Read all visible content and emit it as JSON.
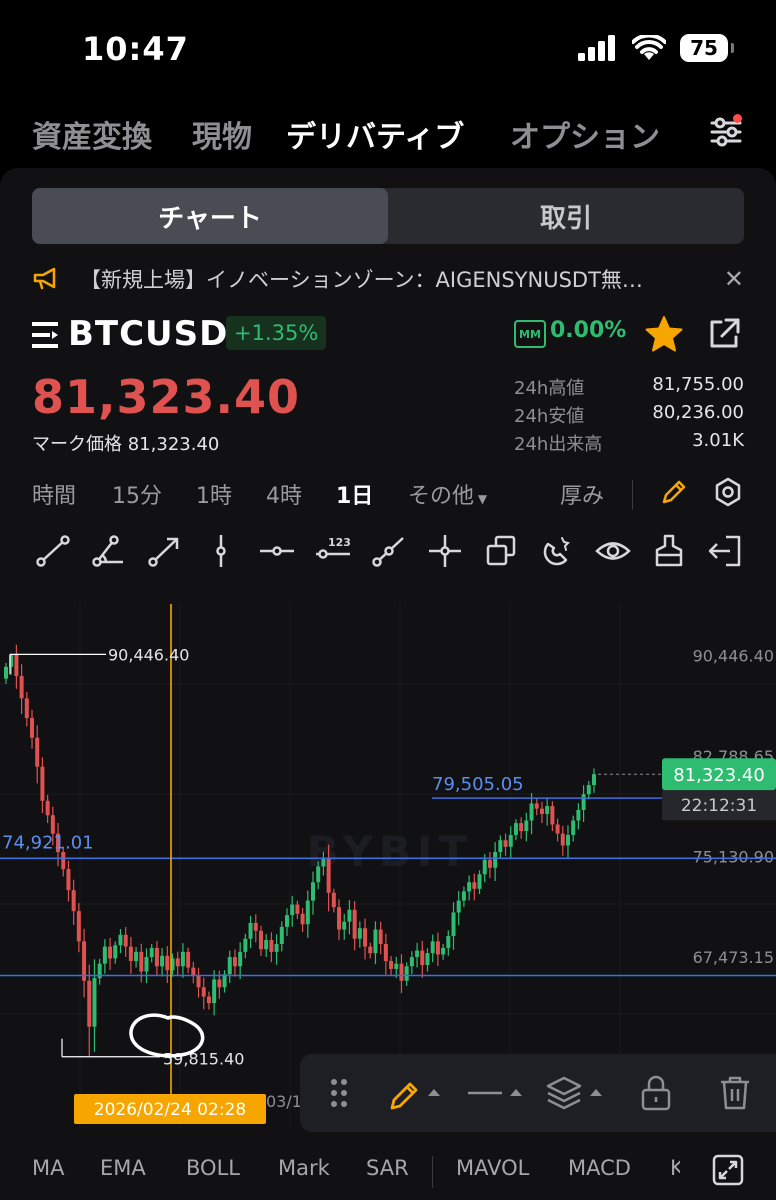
{
  "status": {
    "time": "10:47",
    "battery": "75"
  },
  "top_nav": [
    "資産変換",
    "現物",
    "デリバティブ",
    "オプション"
  ],
  "segment": {
    "chart": "チャート",
    "trade": "取引"
  },
  "announcement": "【新規上場】イノベーションゾーン：AIGENSYNUSDT無…",
  "symbol": {
    "name": "BTCUSD",
    "change": "+1.35%",
    "mm_badge": "MM",
    "mm_value": "0.00%",
    "last_price": "81,323.40",
    "mark_label": "マーク価格",
    "mark_value": "81,323.40",
    "high_label": "24h高値",
    "high_value": "81,755.00",
    "low_label": "24h安値",
    "low_value": "80,236.00",
    "vol_label": "24h出来高",
    "vol_value": "3.01K"
  },
  "timeframes": [
    "時間",
    "15分",
    "1時",
    "4時",
    "1日",
    "その他"
  ],
  "active_timeframe": "1日",
  "depth_label": "厚み",
  "colors": {
    "up": "#2ebd70",
    "down": "#e0524f",
    "accent": "#f7a600",
    "line": "#3d6fe0",
    "label_blue": "#5a8ff0"
  },
  "chart_data": {
    "type": "candlestick",
    "symbol": "BTCUSD",
    "interval": "1日",
    "y_axis_labels": [
      "90,446.40",
      "82,788.65",
      "75,130.90",
      "67,473.15"
    ],
    "x_axis_labels": [
      "03/1"
    ],
    "watermark": "BYBIT",
    "high_marker": "90,446.40",
    "low_marker": "59,815.40",
    "last_price_tag": "81,323.40",
    "countdown": "22:12:31",
    "horizontal_lines": [
      {
        "label": "79,505.05",
        "value": 79505.05
      },
      {
        "label": "74,921.01",
        "value": 74921.01
      },
      {
        "label": "",
        "value": 66000
      }
    ],
    "crosshair_time": "2026/02/24 02:28",
    "ylim": [
      58500,
      92000
    ],
    "closes": [
      89500,
      90446,
      88800,
      87100,
      85600,
      84100,
      81900,
      79300,
      78200,
      76800,
      75400,
      74100,
      72500,
      70900,
      68600,
      65600,
      62100,
      65800,
      66900,
      68200,
      67300,
      68300,
      69100,
      68200,
      67100,
      67800,
      66300,
      67400,
      68100,
      66700,
      67500,
      66400,
      67300,
      66700,
      67800,
      66600,
      66000,
      65100,
      64400,
      63900,
      65700,
      65100,
      66100,
      67400,
      66700,
      67800,
      68800,
      70000,
      69400,
      68000,
      68700,
      67800,
      68400,
      69700,
      70600,
      71400,
      70700,
      69900,
      71700,
      73100,
      74300,
      74900,
      72300,
      71200,
      69500,
      70100,
      71000,
      68800,
      69600,
      68200,
      67700,
      69500,
      68400,
      67100,
      66500,
      66900,
      65600,
      66700,
      67400,
      67900,
      66800,
      67700,
      68600,
      67600,
      68100,
      69000,
      70800,
      71700,
      72400,
      73100,
      72600,
      73700,
      74800,
      74200,
      75400,
      76300,
      75800,
      76700,
      77600,
      77000,
      77800,
      79100,
      78700,
      78300,
      78900,
      77500,
      76800,
      75900,
      76700,
      77800,
      78600,
      79800,
      80500,
      81323
    ]
  },
  "drawing_toolbar": {
    "pencil": "pencil-icon",
    "line_style": "line-style",
    "layers": "layers-icon",
    "lock": "lock-icon",
    "delete": "trash-icon"
  },
  "indicators": [
    "MA",
    "EMA",
    "BOLL",
    "Mark",
    "SAR",
    "MAVOL",
    "MACD",
    "K"
  ]
}
